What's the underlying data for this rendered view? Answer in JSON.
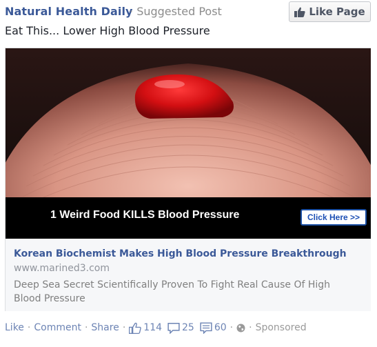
{
  "post": {
    "page_name": "Natural Health Daily",
    "separator": "·",
    "label": "Suggested Post",
    "like_page_button": "Like Page",
    "text": "Eat This... Lower High Blood Pressure"
  },
  "ad": {
    "banner_text": "1 Weird Food KILLS Blood Pressure",
    "cta_button": "Click Here >>",
    "title": "Korean Biochemist Makes High Blood Pressure Breakthrough",
    "url": "www.marined3.com",
    "description": "Deep Sea Secret Scientifically Proven To Fight Real Cause Of High Blood Pressure",
    "image_subject": "drop of blood on fingertip"
  },
  "actions": {
    "like": "Like",
    "comment": "Comment",
    "share": "Share",
    "dot": "·",
    "likes_count": "114",
    "shares_count": "25",
    "comments_count": "60",
    "sponsored": "Sponsored"
  },
  "icons": {
    "like_page": "thumbs-up-icon",
    "likes": "thumbs-up-icon",
    "shares": "share-bubble-icon",
    "comments": "comment-icon",
    "audience": "globe-icon"
  },
  "colors": {
    "brand": "#3b5998",
    "link": "#6d84b4",
    "muted": "#8c8c8c",
    "cta": "#1c4fb4"
  }
}
